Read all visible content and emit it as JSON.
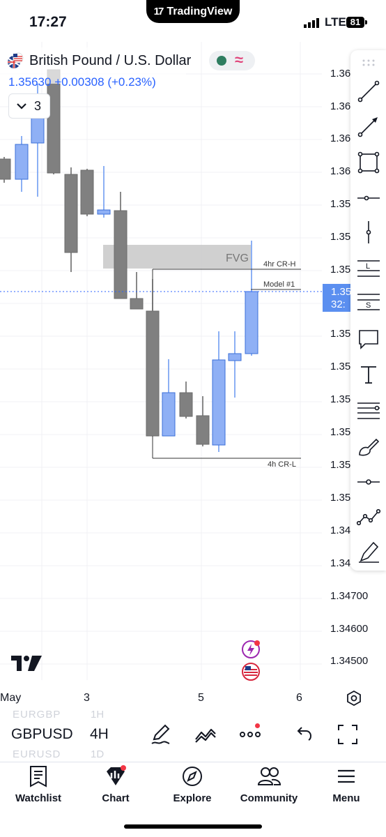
{
  "status_bar": {
    "time": "17:27",
    "app": "TradingView",
    "network": "LTE",
    "battery": "81"
  },
  "symbol": {
    "name": "British Pound / U.S. Dollar",
    "price": "1.35630",
    "change": "+0.00308",
    "change_pct": "(+0.23%)",
    "indicators_count": "3"
  },
  "price_axis": {
    "labels": [
      "1.36",
      "1.36",
      "1.36",
      "1.36",
      "1.35",
      "1.35",
      "1.35",
      "1.35",
      "1.35",
      "1.35",
      "1.35",
      "1.35",
      "1.35",
      "1.34",
      "1.34",
      "1.34700",
      "1.34600",
      "1.34500"
    ],
    "current_tag": {
      "price": "1.35",
      "countdown": "32:"
    }
  },
  "x_axis": {
    "labels": [
      "May",
      "3",
      "5",
      "6"
    ]
  },
  "annotations": {
    "fvg": "FVG",
    "cr_high": "4hr CR-H",
    "model": "Model #1",
    "cr_low": "4h CR-L"
  },
  "colors": {
    "bull": "#8fb0f5",
    "bear": "#808080",
    "accent": "#2962ff",
    "fvg": "#c8c8c8"
  },
  "drawing_tools": [
    "trend-line-icon",
    "arrow-line-icon",
    "rectangle-icon",
    "horizontal-line-icon",
    "vertical-line-icon",
    "long-position-icon",
    "short-position-icon",
    "comment-icon",
    "text-icon",
    "fib-retracement-icon",
    "brush-icon",
    "horizontal-ray-icon",
    "path-icon",
    "highlighter-icon"
  ],
  "toolbar": {
    "symbol": "GBPUSD",
    "interval": "4H",
    "faded_above": {
      "symbol": "EURGBP",
      "interval": "1H"
    },
    "faded_below": {
      "symbol": "EURUSD",
      "interval": "1D"
    }
  },
  "tabs": [
    {
      "label": "Watchlist",
      "icon": "watchlist-icon"
    },
    {
      "label": "Chart",
      "icon": "chart-icon"
    },
    {
      "label": "Explore",
      "icon": "compass-icon"
    },
    {
      "label": "Community",
      "icon": "community-icon"
    },
    {
      "label": "Menu",
      "icon": "menu-icon"
    }
  ]
}
